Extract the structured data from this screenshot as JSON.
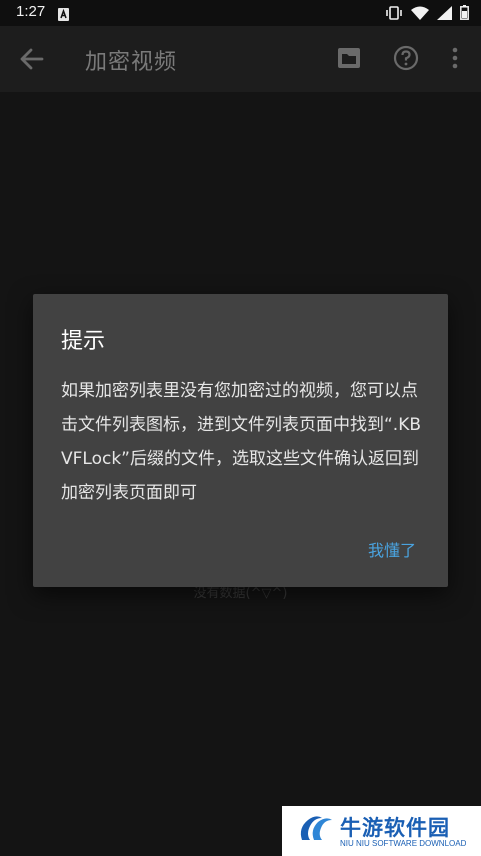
{
  "status_bar": {
    "time": "1:27",
    "icons": [
      "notification-a-icon",
      "vibrate-icon",
      "wifi-icon",
      "signal-icon",
      "battery-icon"
    ]
  },
  "toolbar": {
    "title": "加密视频",
    "icons": [
      "back-arrow-icon",
      "folder-icon",
      "help-icon",
      "more-vert-icon"
    ]
  },
  "content": {
    "empty_text": "没有数据(^▽^)"
  },
  "dialog": {
    "title": "提示",
    "message": "如果加密列表里没有您加密过的视频，您可以点击文件列表图标，进到文件列表页面中找到“.KBVFLock”后缀的文件，选取这些文件确认返回到加密列表页面即可",
    "button_label": "我懂了"
  },
  "watermark": {
    "name": "牛游软件园",
    "subtitle": "NIU NIU SOFTWARE DOWNLOAD"
  },
  "colors": {
    "background": "#141414",
    "toolbar": "#1d1d1d",
    "dialog": "#424242",
    "accent": "#4aa3df",
    "brand": "#1a5fb4"
  }
}
